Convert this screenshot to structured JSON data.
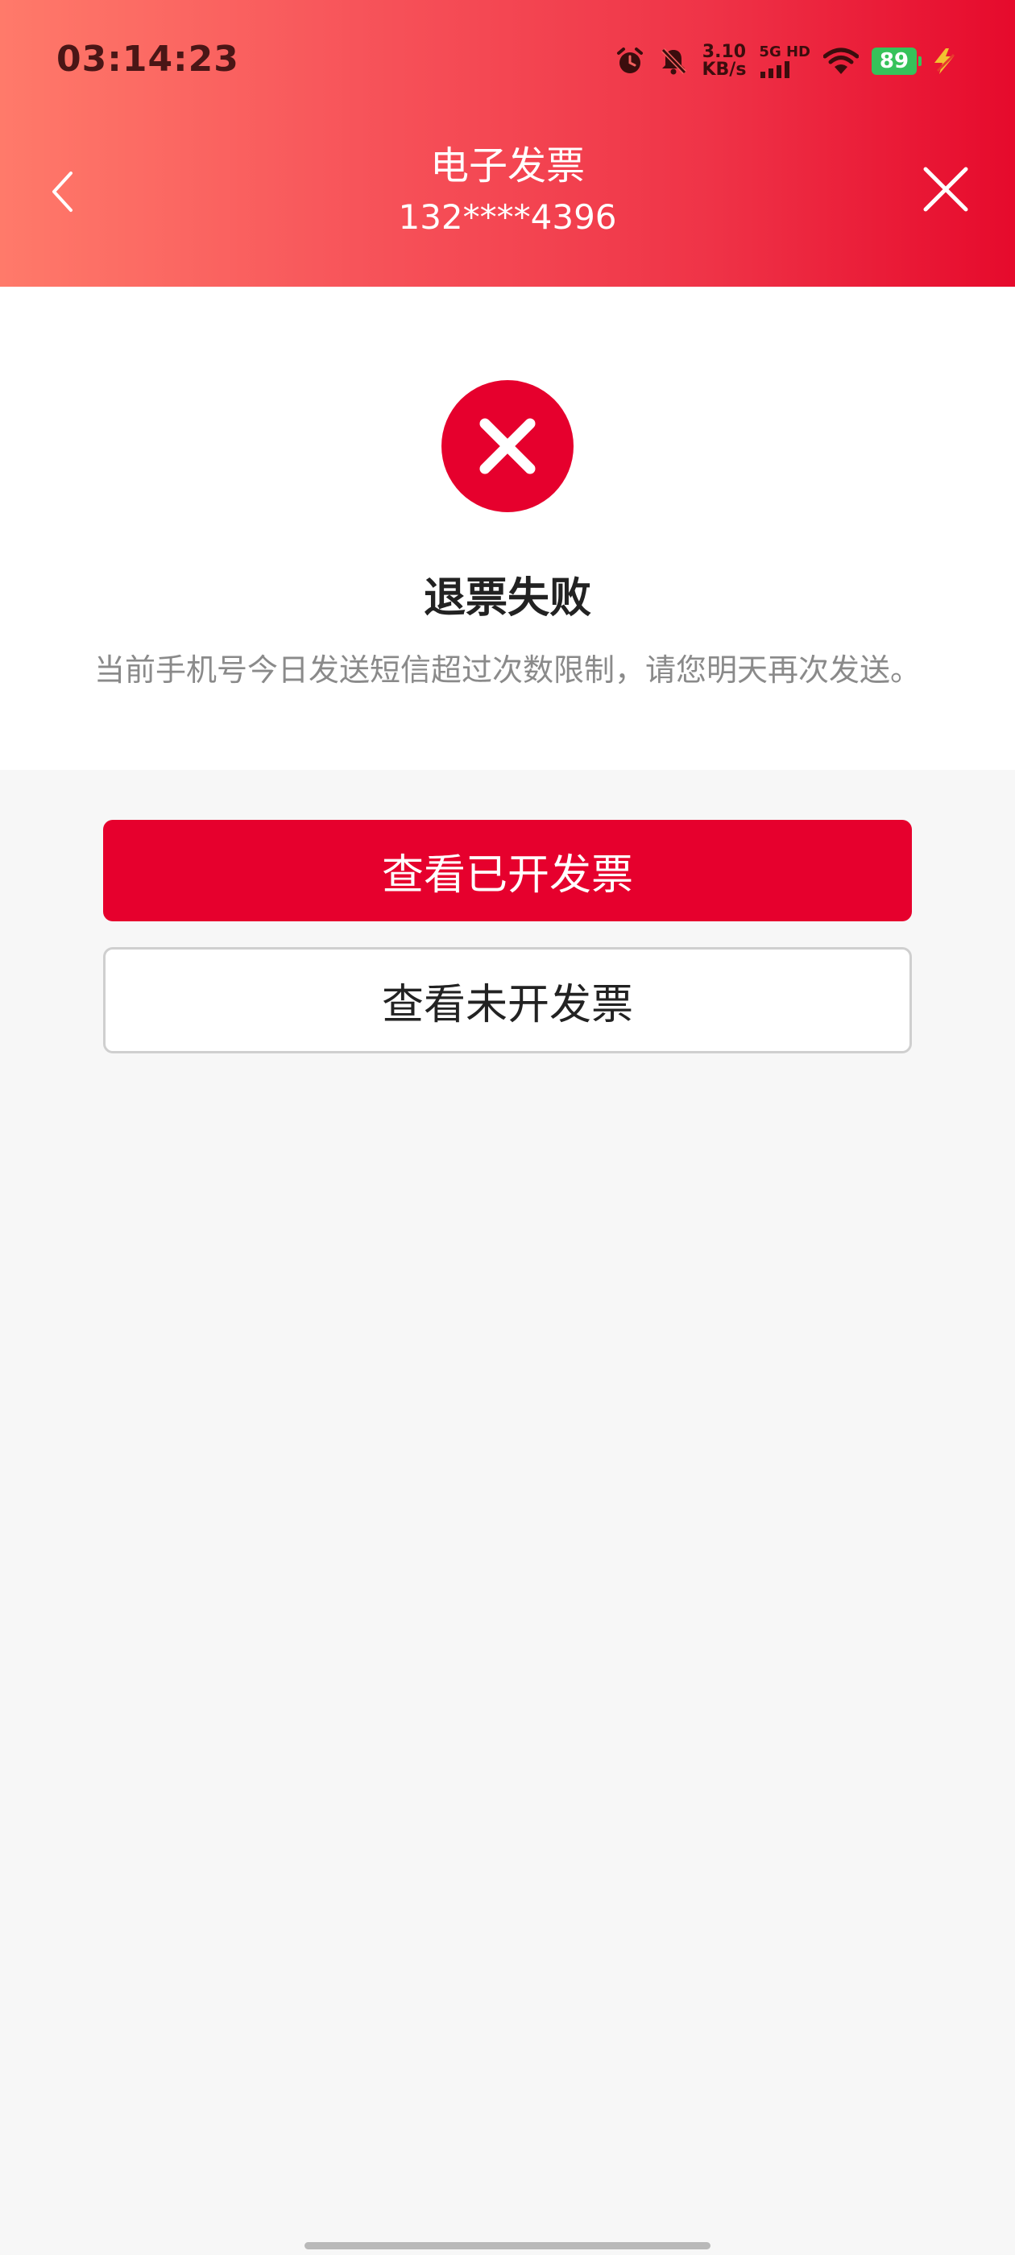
{
  "status_bar": {
    "time": "03:14:23",
    "net_speed_value": "3.10",
    "net_speed_unit": "KB/s",
    "net_type_top": "5G HD",
    "battery_level": "89",
    "icons": [
      "alarm-icon",
      "mute-icon",
      "signal-icon",
      "wifi-icon",
      "battery-icon",
      "charging-icon"
    ],
    "battery_color": "#36c25a",
    "charging_color": "#f2c230"
  },
  "nav": {
    "title": "电子发票",
    "subtitle": "132****4396",
    "back_icon": "chevron-left-icon",
    "close_icon": "close-icon",
    "gradient_start": "#ff7a6a",
    "gradient_end": "#e60a2c"
  },
  "result": {
    "icon": "error-x-icon",
    "icon_color": "#e6002d",
    "title": "退票失败",
    "description": "当前手机号今日发送短信超过次数限制，请您明天再次发送。"
  },
  "actions": {
    "primary_label": "查看已开发票",
    "secondary_label": "查看未开发票",
    "primary_color": "#e6002d"
  }
}
